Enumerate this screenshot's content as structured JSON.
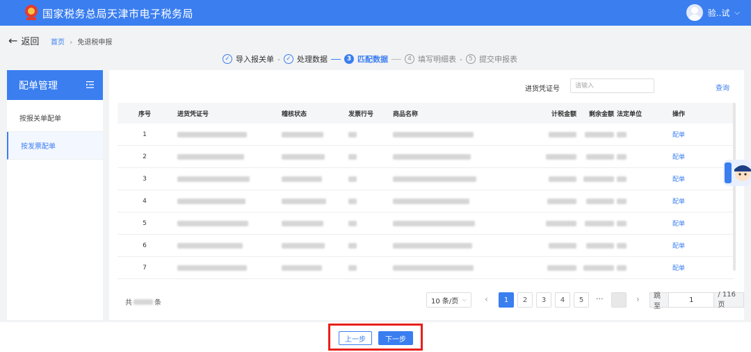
{
  "header": {
    "title": "国家税务总局天津市电子税务局",
    "user_name": "验..试"
  },
  "nav": {
    "back_label": "返回",
    "crumb_home": "首页",
    "crumb_current": "免退税申报"
  },
  "steps": [
    {
      "index": "✓",
      "label": "导入报关单",
      "state": "done"
    },
    {
      "index": "✓",
      "label": "处理数据",
      "state": "done"
    },
    {
      "index": "3",
      "label": "匹配数据",
      "state": "active"
    },
    {
      "index": "4",
      "label": "填写明细表",
      "state": "todo"
    },
    {
      "index": "5",
      "label": "提交申报表",
      "state": "todo"
    }
  ],
  "sidebar": {
    "title": "配单管理",
    "items": [
      {
        "label": "按报关单配单",
        "active": false
      },
      {
        "label": "按发票配单",
        "active": true
      }
    ]
  },
  "filter": {
    "label": "进货凭证号",
    "placeholder": "请输入",
    "query_label": "查询"
  },
  "table": {
    "columns": [
      "序号",
      "进货凭证号",
      "稽核状态",
      "发票行号",
      "商品名称",
      "计税金额",
      "剩余金额",
      "法定单位",
      "操作"
    ],
    "rows": [
      {
        "seq": "1",
        "action": "配单"
      },
      {
        "seq": "2",
        "action": "配单"
      },
      {
        "seq": "3",
        "action": "配单"
      },
      {
        "seq": "4",
        "action": "配单"
      },
      {
        "seq": "5",
        "action": "配单"
      },
      {
        "seq": "6",
        "action": "配单"
      },
      {
        "seq": "7",
        "action": "配单"
      }
    ]
  },
  "pagination": {
    "total_prefix": "共",
    "total_suffix": "条",
    "page_size": "10 条/页",
    "pages": [
      "1",
      "2",
      "3",
      "4",
      "5"
    ],
    "current_page": "1",
    "ellipsis": "···",
    "jump_label": "跳至",
    "jump_value": "1",
    "total_pages": "/ 116 页"
  },
  "actions": {
    "prev_label": "上一步",
    "next_label": "下一步"
  },
  "colors": {
    "primary": "#3a7ef0",
    "highlight": "#e8201b"
  }
}
